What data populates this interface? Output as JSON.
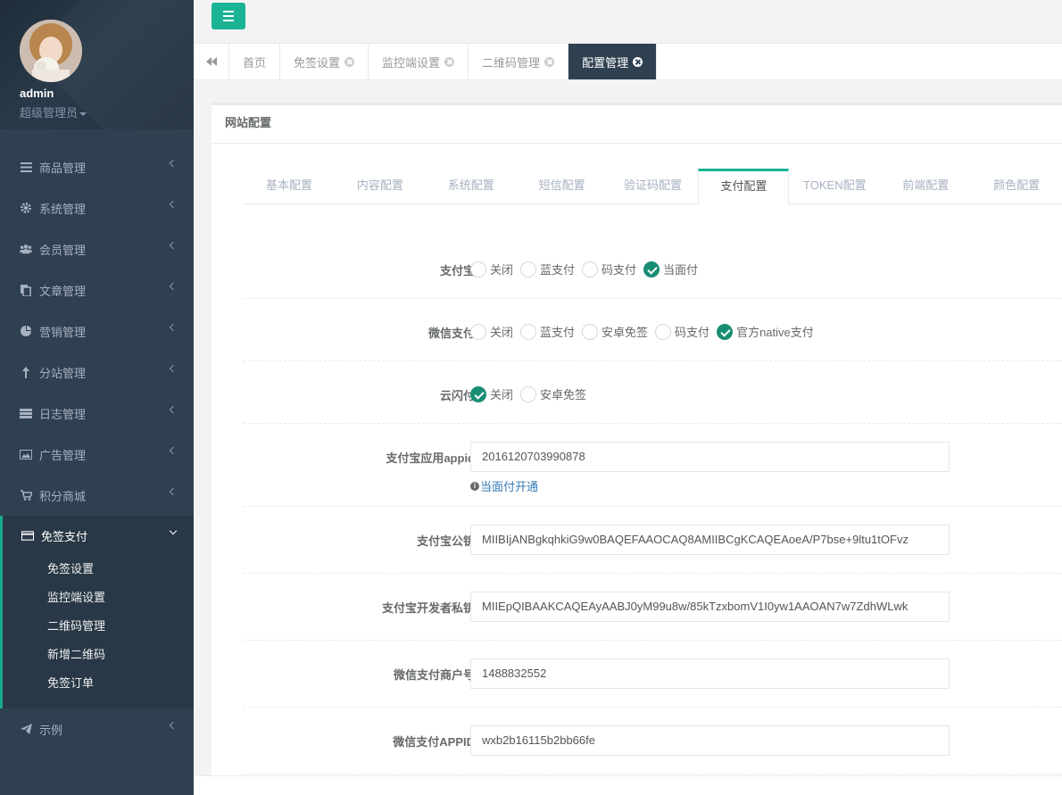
{
  "profile": {
    "name": "admin",
    "role": "超级管理员"
  },
  "sidebar": {
    "items": [
      {
        "label": "商品管理",
        "icon": "bars-icon"
      },
      {
        "label": "系统管理",
        "icon": "gear-icon"
      },
      {
        "label": "会员管理",
        "icon": "users-icon"
      },
      {
        "label": "文章管理",
        "icon": "files-icon"
      },
      {
        "label": "营销管理",
        "icon": "pie-chart-icon"
      },
      {
        "label": "分站管理",
        "icon": "tree-icon"
      },
      {
        "label": "日志管理",
        "icon": "server-icon"
      },
      {
        "label": "广告管理",
        "icon": "image-icon"
      },
      {
        "label": "积分商城",
        "icon": "cart-icon"
      }
    ],
    "active": {
      "label": "免签支付",
      "icon": "credit-card-icon",
      "sub": [
        "免签设置",
        "监控端设置",
        "二维码管理",
        "新增二维码",
        "免签订单"
      ]
    },
    "last": {
      "label": "示例",
      "icon": "paper-plane-icon"
    }
  },
  "tabs": [
    {
      "label": "首页",
      "closable": false
    },
    {
      "label": "免签设置",
      "closable": true
    },
    {
      "label": "监控端设置",
      "closable": true
    },
    {
      "label": "二维码管理",
      "closable": true
    },
    {
      "label": "配置管理",
      "closable": true,
      "active": true
    }
  ],
  "panel": {
    "title": "网站配置",
    "config_tabs": [
      "基本配置",
      "内容配置",
      "系统配置",
      "短信配置",
      "验证码配置",
      "支付配置",
      "TOKEN配置",
      "前端配置",
      "颜色配置"
    ],
    "active_tab": "支付配置"
  },
  "form": {
    "alipay": {
      "label": "支付宝：",
      "options": [
        "关闭",
        "蓝支付",
        "码支付",
        "当面付"
      ],
      "selected": "当面付"
    },
    "wechat": {
      "label": "微信支付：",
      "options": [
        "关闭",
        "蓝支付",
        "安卓免签",
        "码支付",
        "官方native支付"
      ],
      "selected": "官方native支付"
    },
    "unionpay": {
      "label": "云闪付：",
      "options": [
        "关闭",
        "安卓免签"
      ],
      "selected": "关闭"
    },
    "alipay_appid": {
      "label": "支付宝应用appid：",
      "value": "2016120703990878",
      "help": "当面付开通"
    },
    "alipay_pubkey": {
      "label": "支付宝公钥：",
      "value": "MIIBIjANBgkqhkiG9w0BAQEFAAOCAQ8AMIIBCgKCAQEAoeA/P7bse+9ltu1tOFvz"
    },
    "alipay_privkey": {
      "label": "支付宝开发者私钥：",
      "value": "MIIEpQIBAAKCAQEAyAABJ0yM99u8w/85kTzxbomV1I0yw1AAOAN7w7ZdhWLwk"
    },
    "wx_mchid": {
      "label": "微信支付商户号：",
      "value": "1488832552"
    },
    "wx_appid": {
      "label": "微信支付APPID：",
      "value": "wxb2b16115b2bb66fe"
    }
  },
  "colors": {
    "accent": "#1ab394",
    "sidebar": "#2f4050",
    "checked": "#1a8d75"
  }
}
